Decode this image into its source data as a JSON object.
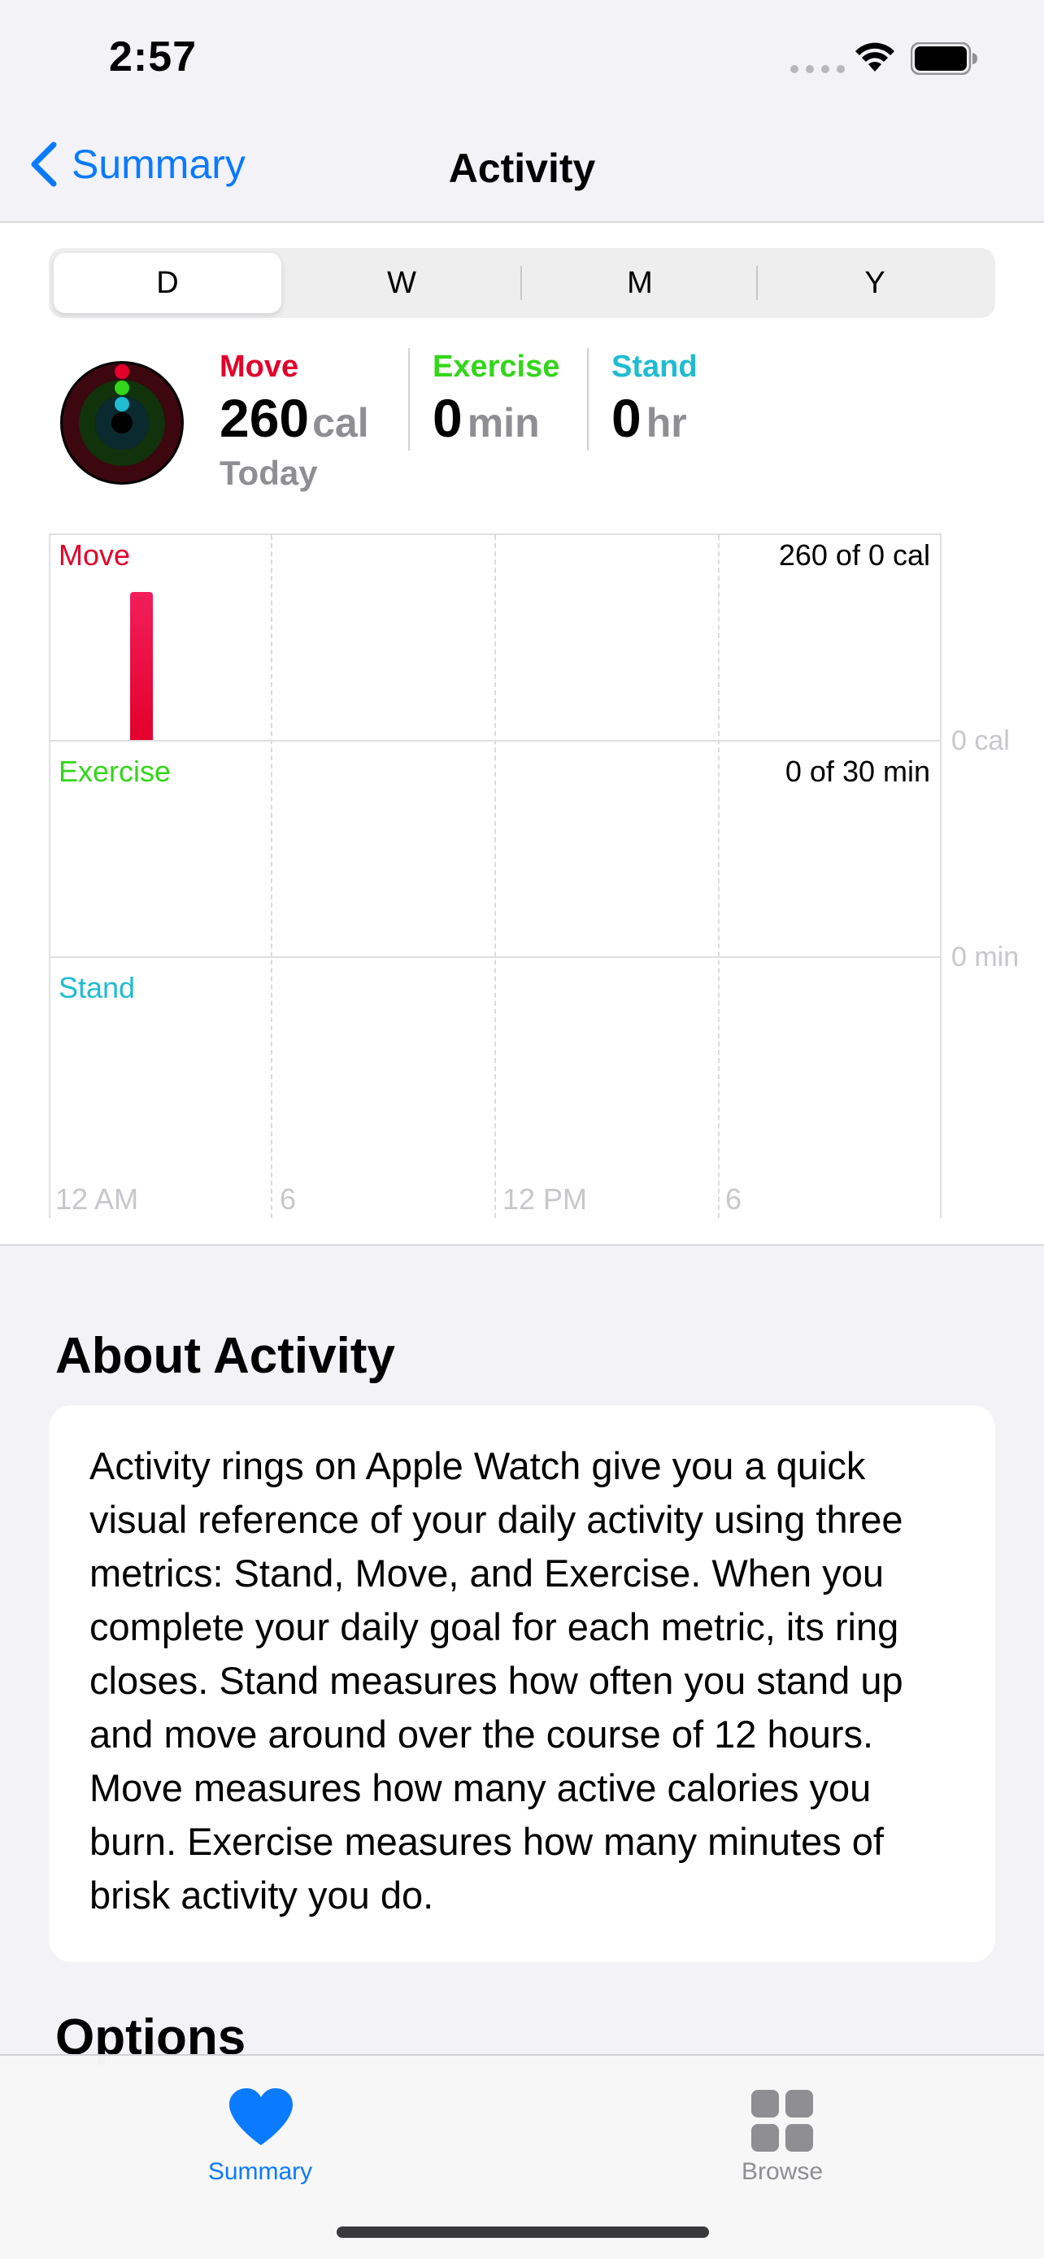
{
  "status_bar": {
    "time": "2:57"
  },
  "nav": {
    "back_label": "Summary",
    "title": "Activity"
  },
  "segments": [
    "D",
    "W",
    "M",
    "Y"
  ],
  "selected_segment": "D",
  "summary": {
    "move": {
      "label": "Move",
      "value": "260",
      "unit": "cal",
      "sub": "Today",
      "color": "#e3002b"
    },
    "exercise": {
      "label": "Exercise",
      "value": "0",
      "unit": "min",
      "color": "#33d61a"
    },
    "stand": {
      "label": "Stand",
      "value": "0",
      "unit": "hr",
      "color": "#1fbcd2"
    }
  },
  "chart": {
    "sections": [
      {
        "label": "Move",
        "goal_text": "260 of 0 cal",
        "axis_label": "0 cal"
      },
      {
        "label": "Exercise",
        "goal_text": "0 of 30 min",
        "axis_label": "0 min"
      },
      {
        "label": "Stand"
      }
    ],
    "x_labels": [
      "12 AM",
      "6",
      "12 PM",
      "6"
    ]
  },
  "chart_data": {
    "type": "bar",
    "series": [
      {
        "name": "Move",
        "values": [
          260
        ]
      },
      {
        "name": "Exercise",
        "values": [
          0
        ]
      },
      {
        "name": "Stand",
        "values": [
          0
        ]
      }
    ],
    "x_ticks": [
      "12 AM",
      "6",
      "12 PM",
      "6"
    ]
  },
  "about": {
    "heading": "About Activity",
    "body": "Activity rings on Apple Watch give you a quick visual reference of your daily activity using three metrics: Stand, Move, and Exercise. When you complete your daily goal for each metric, its ring closes. Stand measures how often you stand up and move around over the course of 12 hours. Move measures how many active calories you burn. Exercise measures how many minutes of brisk activity you do."
  },
  "peek_heading": "Options",
  "tabbar": {
    "summary_label": "Summary",
    "browse_label": "Browse",
    "active_color": "#0a7aff",
    "inactive_color": "#8e8e93"
  }
}
